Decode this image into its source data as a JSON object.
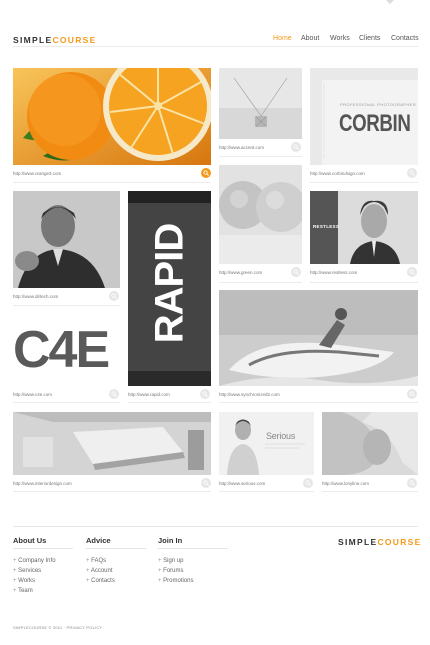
{
  "brand": {
    "part1": "SIMPLE",
    "part2": "COURSE",
    "accent_color": "#f39a1c"
  },
  "nav": {
    "items": [
      "Home",
      "About",
      "Works",
      "Clients",
      "Contacts"
    ],
    "active": "Home"
  },
  "portfolio": [
    {
      "id": "orange",
      "url": "http://www.orange3.com"
    },
    {
      "id": "accent",
      "url": "http://www.accent.com"
    },
    {
      "id": "corbin",
      "url": "http://www.corbindsign.com",
      "image_text": {
        "tagline": "PROFESSIONAL PHOTOGRAPHER",
        "name": "CORBIN"
      }
    },
    {
      "id": "dirtech",
      "url": "http://www.dirtech.com"
    },
    {
      "id": "rapid",
      "url": "http://www.rapid.com",
      "image_text": {
        "word": "RAPID"
      }
    },
    {
      "id": "green",
      "url": "http://www.green.com"
    },
    {
      "id": "restless",
      "url": "http://www.restless.com",
      "image_text": {
        "label": "RESTLESS"
      }
    },
    {
      "id": "c4e",
      "url": "http://www.c4e.com",
      "image_text": {
        "word": "C4E"
      }
    },
    {
      "id": "synchronized",
      "url": "http://www.synchronized2.com"
    },
    {
      "id": "interior",
      "url": "http://www.interiordesign.com"
    },
    {
      "id": "serious",
      "url": "http://www.serious.com",
      "image_text": {
        "word": "Serious"
      }
    },
    {
      "id": "loneyline",
      "url": "http://www.lonyline.com"
    }
  ],
  "footer": {
    "columns": [
      {
        "title": "About Us",
        "links": [
          "Company Info",
          "Services",
          "Works",
          "Team"
        ]
      },
      {
        "title": "Advice",
        "links": [
          "FAQs",
          "Account",
          "Contacts"
        ]
      },
      {
        "title": "Join In",
        "links": [
          "Sign up",
          "Forums",
          "Promotions"
        ]
      }
    ],
    "copyright": "SIMPLECOURSE © 2011 · PRIVACY POLICY"
  }
}
